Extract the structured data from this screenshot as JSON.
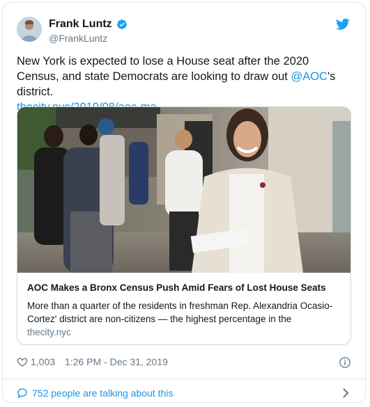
{
  "author": {
    "name": "Frank Luntz",
    "handle": "@FrankLuntz"
  },
  "icons": {
    "verified": "verified-badge-icon",
    "logo": "twitter-bird-icon",
    "like": "heart-icon",
    "info": "info-icon",
    "reply": "speech-bubble-icon",
    "more": "chevron-right-icon"
  },
  "tweet": {
    "text_part1": "New York is expected to lose a House seat after the 2020 Census, and state Democrats are looking to draw out ",
    "mention": "@AOC",
    "text_part2": "'s district.",
    "link": "thecity.nyc/2019/08/aoc-ma…"
  },
  "card": {
    "title": "AOC Makes a Bronx Census Push Amid Fears of Lost House Seats",
    "description": "More than a quarter of the residents in freshman Rep. Alexandria Ocasio-Cortez' district are non-citizens — the highest percentage in the",
    "domain": "thecity.nyc"
  },
  "meta": {
    "likes": "1,003",
    "timestamp": "1:26 PM - Dec 31, 2019"
  },
  "footer": {
    "talking": "752 people are talking about this"
  },
  "colors": {
    "link": "#1b95e0",
    "secondary_text": "#657786",
    "border": "#e1e8ed"
  }
}
